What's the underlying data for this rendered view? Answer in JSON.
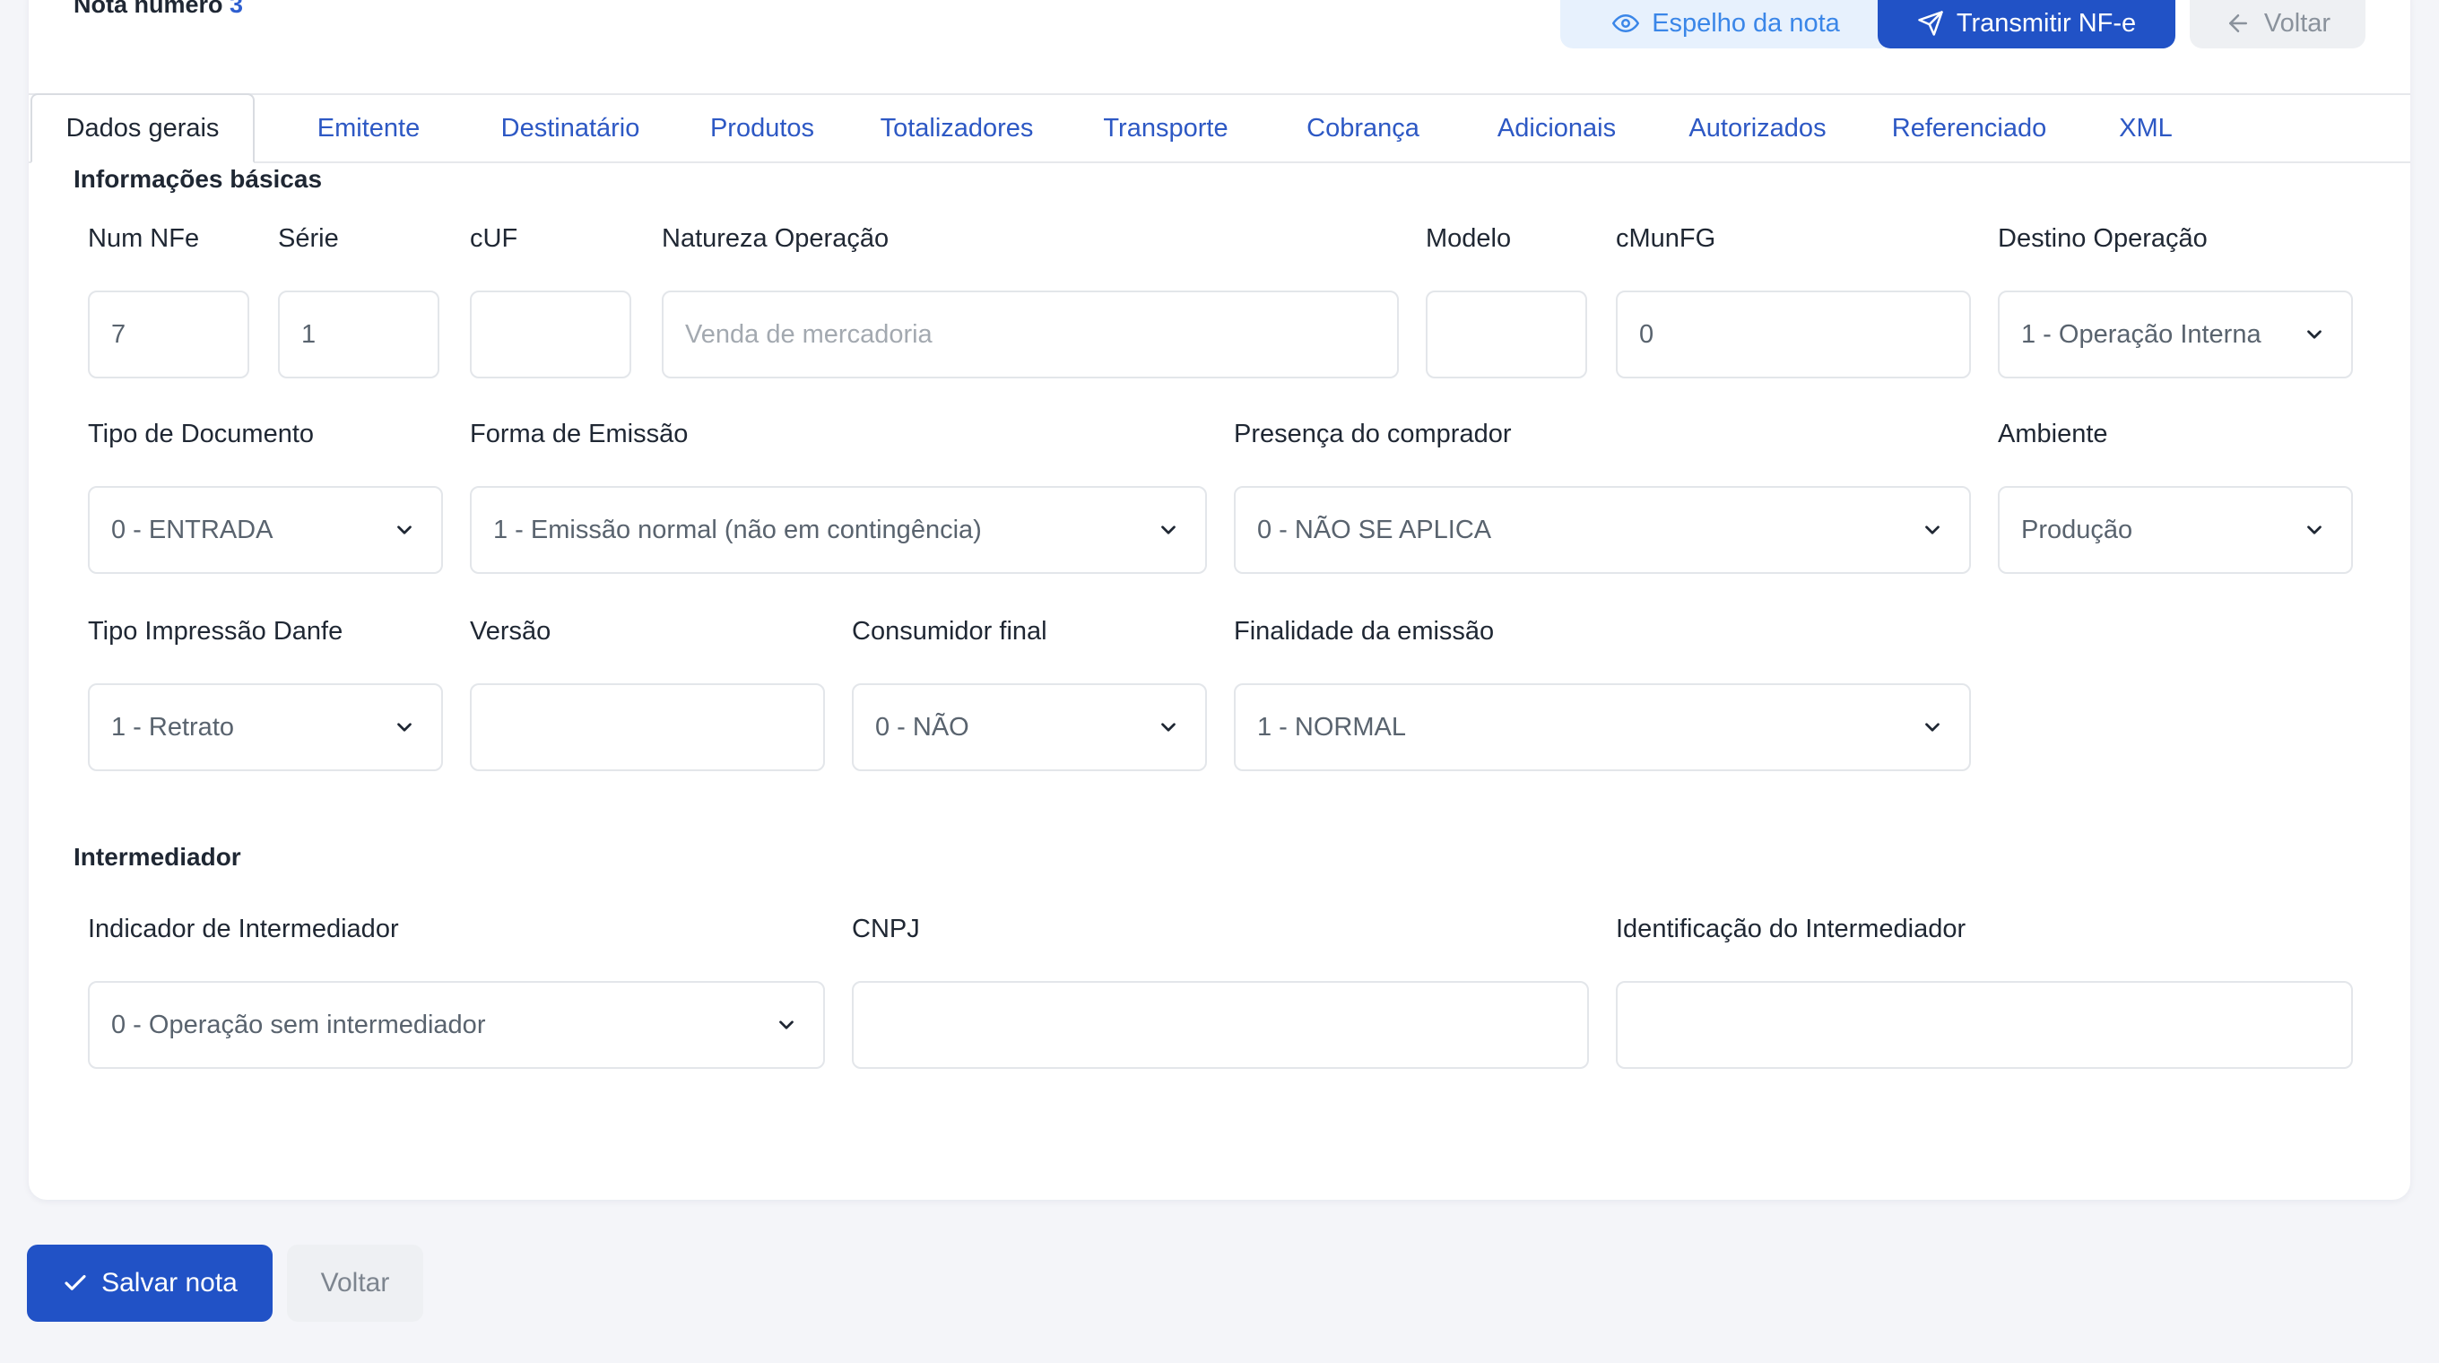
{
  "header": {
    "title_prefix": "Nota número",
    "note_number": "3",
    "mirror_label": "Espelho da nota",
    "transmit_label": "Transmitir NF-e",
    "back_label": "Voltar"
  },
  "tabs": [
    {
      "label": "Dados gerais",
      "active": true
    },
    {
      "label": "Emitente"
    },
    {
      "label": "Destinatário"
    },
    {
      "label": "Produtos"
    },
    {
      "label": "Totalizadores"
    },
    {
      "label": "Transporte"
    },
    {
      "label": "Cobrança"
    },
    {
      "label": "Adicionais"
    },
    {
      "label": "Autorizados"
    },
    {
      "label": "Referenciado"
    },
    {
      "label": "XML"
    }
  ],
  "basic": {
    "section_title": "Informações básicas",
    "num_nfe": {
      "label": "Num NFe",
      "value": "7"
    },
    "serie": {
      "label": "Série",
      "value": "1"
    },
    "cuf": {
      "label": "cUF",
      "value": ""
    },
    "natureza": {
      "label": "Natureza Operação",
      "placeholder": "Venda de mercadoria"
    },
    "modelo": {
      "label": "Modelo",
      "value": ""
    },
    "cmunfg": {
      "label": "cMunFG",
      "value": "0"
    },
    "destino": {
      "label": "Destino Operação",
      "value": "1 - Operação Interna"
    },
    "tipo_doc": {
      "label": "Tipo de Documento",
      "value": "0 - ENTRADA"
    },
    "forma_emissao": {
      "label": "Forma de Emissão",
      "value": "1 - Emissão normal (não em contingência)"
    },
    "presenca": {
      "label": "Presença do comprador",
      "value": "0 - NÃO SE APLICA"
    },
    "ambiente": {
      "label": "Ambiente",
      "value": "Produção"
    },
    "tipo_impressao": {
      "label": "Tipo Impressão Danfe",
      "value": "1 - Retrato"
    },
    "versao": {
      "label": "Versão",
      "value": ""
    },
    "consumidor_final": {
      "label": "Consumidor final",
      "value": "0 - NÃO"
    },
    "finalidade": {
      "label": "Finalidade da emissão",
      "value": "1 - NORMAL"
    }
  },
  "intermediador": {
    "section_title": "Intermediador",
    "indicador": {
      "label": "Indicador de Intermediador",
      "value": "0 - Operação sem intermediador"
    },
    "cnpj": {
      "label": "CNPJ",
      "value": ""
    },
    "identificacao": {
      "label": "Identificação do Intermediador",
      "value": ""
    }
  },
  "footer": {
    "save_label": "Salvar nota",
    "back_label": "Voltar"
  },
  "colors": {
    "primary": "#2152c6",
    "link": "#2d58c4",
    "mirror_bg": "#e7f1fd",
    "page_bg": "#f4f5f9"
  },
  "icons": {
    "mirror": "eye-icon",
    "transmit": "send-icon",
    "back": "arrow-left-icon",
    "save": "check-icon",
    "select": "chevron-down-icon"
  }
}
